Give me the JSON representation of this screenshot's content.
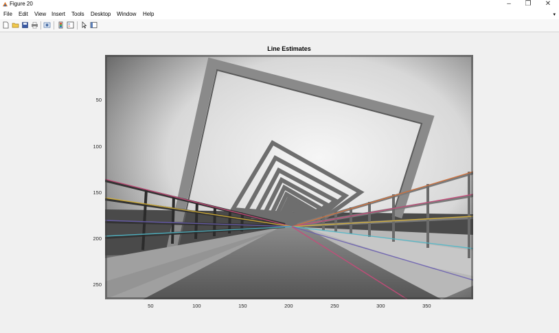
{
  "window": {
    "title": "Figure 20",
    "controls": {
      "minimize": "–",
      "restore": "❐",
      "close": "✕"
    }
  },
  "menu": [
    "File",
    "Edit",
    "View",
    "Insert",
    "Tools",
    "Desktop",
    "Window",
    "Help"
  ],
  "toolbar": {
    "buttons": [
      "new-figure-icon",
      "open-file-icon",
      "save-icon",
      "print-icon",
      "link-plot-icon",
      "insert-colorbar-icon",
      "insert-legend-icon",
      "edit-plot-icon",
      "property-inspector-icon"
    ]
  },
  "figure": {
    "title": "Line Estimates",
    "image_width": 400,
    "image_height": 265,
    "x_ticks": [
      50,
      100,
      150,
      200,
      250,
      300,
      350
    ],
    "y_ticks": [
      50,
      100,
      150,
      200,
      250
    ]
  },
  "colors": {
    "titlebar_bg": "#ffffff",
    "figure_bg": "#f0f0f0",
    "estimated_lines": [
      "#c94a7a",
      "#d7b23a",
      "#6a5fb0",
      "#52b8c8",
      "#d9733a"
    ]
  }
}
